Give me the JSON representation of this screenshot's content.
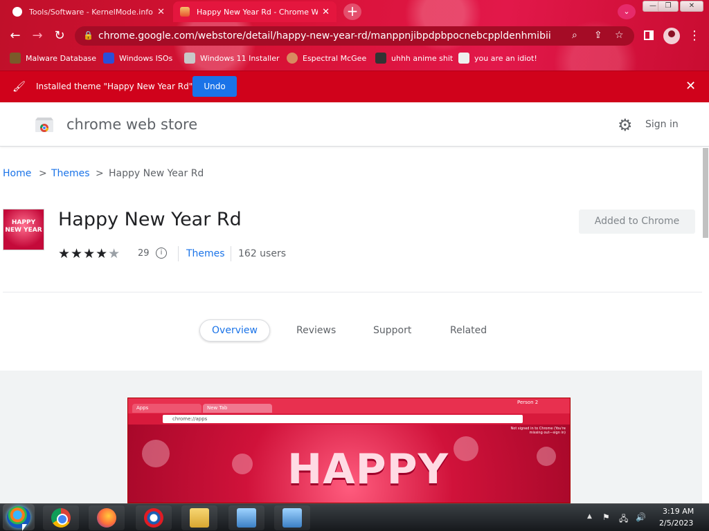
{
  "browser": {
    "tabs": [
      {
        "title": "Tools/Software - KernelMode.info",
        "active": false
      },
      {
        "title": "Happy New Year Rd - Chrome Web Store",
        "active": true
      }
    ],
    "new_tab_label": "+",
    "address": "chrome.google.com/webstore/detail/happy-new-year-rd/manppnjibpdpbpocnebcppldenhmibii",
    "bookmarks": [
      {
        "label": "Malware Database",
        "icon": "malware-db-icon",
        "color": "#7a5a2a"
      },
      {
        "label": "Windows ISOs",
        "icon": "x-icon",
        "color": "#2a4fd8"
      },
      {
        "label": "Windows 11 Installer",
        "icon": "installer-icon",
        "color": "#c8c8c8"
      },
      {
        "label": "Espectral McGee",
        "icon": "avatar-icon",
        "color": "#d88a60"
      },
      {
        "label": "uhhh anime shit",
        "icon": "anime-icon",
        "color": "#333333"
      },
      {
        "label": "you are an idiot!",
        "icon": "idiot-icon",
        "color": "#eeeeee"
      }
    ]
  },
  "infobar": {
    "message": "Installed theme \"Happy New Year Rd\"",
    "undo_label": "Undo"
  },
  "store": {
    "name": "chrome web store",
    "signin_label": "Sign in"
  },
  "breadcrumb": {
    "home": "Home",
    "sep": ">",
    "category": "Themes",
    "current": "Happy New Year Rd"
  },
  "item": {
    "title": "Happy New Year Rd",
    "thumb_text": "HAPPY NEW YEAR",
    "rating_stars": 4,
    "rating_count": "29",
    "info_glyph": "i",
    "category": "Themes",
    "users": "162 users",
    "added_label": "Added to Chrome"
  },
  "detail_tabs": {
    "overview": "Overview",
    "reviews": "Reviews",
    "support": "Support",
    "related": "Related"
  },
  "screenshot": {
    "tab1": "Apps",
    "tab2": "New Tab",
    "person": "Person 2",
    "url": "chrome://apps",
    "not_signed_in": "Not signed in to Chrome (You're missing out—sign in)",
    "headline": "HAPPY"
  },
  "taskbar": {
    "apps": [
      "start-orb",
      "chrome",
      "firefox",
      "internet-explorer",
      "file-explorer",
      "program-1",
      "program-2"
    ],
    "time": "3:19 AM",
    "date": "2/5/2023"
  },
  "colors": {
    "frame": "#d81236",
    "infobar": "#d0021b",
    "link": "#1a73e8",
    "undo": "#1a73e8"
  }
}
